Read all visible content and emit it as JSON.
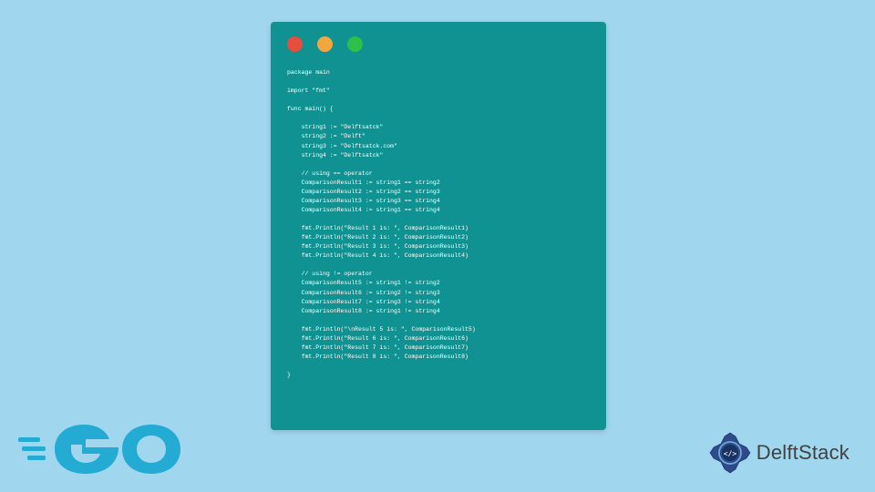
{
  "code": {
    "lines": [
      "package main",
      "",
      "import \"fmt\"",
      "",
      "func main() {",
      "",
      "    string1 := \"Delftsatck\"",
      "    string2 := \"Delft\"",
      "    string3 := \"Delftsatck.com\"",
      "    string4 := \"Delftsatck\"",
      "",
      "    // using == operator",
      "    ComparisonResult1 := string1 == string2",
      "    ComparisonResult2 := string2 == string3",
      "    ComparisonResult3 := string3 == string4",
      "    ComparisonResult4 := string1 == string4",
      "",
      "    fmt.Println(\"Result 1 is: \", ComparisonResult1)",
      "    fmt.Println(\"Result 2 is: \", ComparisonResult2)",
      "    fmt.Println(\"Result 3 is: \", ComparisonResult3)",
      "    fmt.Println(\"Result 4 is: \", ComparisonResult4)",
      "",
      "    // using != operator",
      "    ComparisonResult5 := string1 != string2",
      "    ComparisonResult6 := string2 != string3",
      "    ComparisonResult7 := string3 != string4",
      "    ComparisonResult8 := string1 != string4",
      "",
      "    fmt.Println(\"\\nResult 5 is: \", ComparisonResult5)",
      "    fmt.Println(\"Result 6 is: \", ComparisonResult6)",
      "    fmt.Println(\"Result 7 is: \", ComparisonResult7)",
      "    fmt.Println(\"Result 8 is: \", ComparisonResult8)",
      "",
      "}"
    ]
  },
  "logo_go": "GO",
  "logo_delft": "DelftStack"
}
